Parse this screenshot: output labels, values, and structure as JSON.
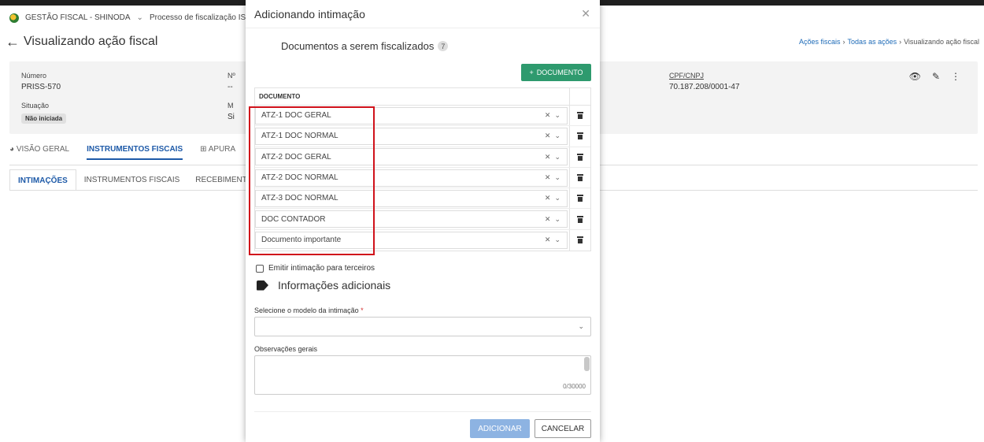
{
  "topbar": {
    "org": "GESTÃO FISCAL - SHINODA",
    "process": "Processo de fiscalização ISS"
  },
  "page": {
    "title": "Visualizando ação fiscal",
    "breadcrumb": [
      "Ações fiscais",
      "Todas as ações",
      "Visualizando ação fiscal"
    ]
  },
  "summary": {
    "numero_label": "Número",
    "numero_value": "PRISS-570",
    "situacao_label": "Situação",
    "situacao_value": "Não iniciada",
    "col2_label_a": "Nº",
    "col2_value_a": "--",
    "col2_label_b": "M",
    "col2_value_b": "Si",
    "cpf_label": "CPF/CNPJ",
    "cpf_value": "70.187.208/0001-47"
  },
  "tabs": {
    "main": [
      "VISÃO GERAL",
      "INSTRUMENTOS FISCAIS",
      "APURA"
    ],
    "sub": [
      "INTIMAÇÕES",
      "INSTRUMENTOS FISCAIS",
      "RECEBIMENT"
    ]
  },
  "modal": {
    "title": "Adicionando intimação",
    "section_title": "Documentos a serem fiscalizados",
    "doc_count": "7",
    "add_doc_label": "DOCUMENTO",
    "table_header": "DOCUMENTO",
    "documents": [
      "ATZ-1 DOC GERAL",
      "ATZ-1 DOC NORMAL",
      "ATZ-2 DOC GERAL",
      "ATZ-2 DOC NORMAL",
      "ATZ-3 DOC NORMAL",
      "DOC CONTADOR",
      "Documento importante"
    ],
    "checkbox_label": "Emitir intimação para terceiros",
    "info_title": "Informações adicionais",
    "model_label": "Selecione o modelo da intimação",
    "model_required": "*",
    "obs_label": "Observações gerais",
    "char_count": "0/30000",
    "add_button": "ADICIONAR",
    "cancel_button": "CANCELAR"
  },
  "colors": {
    "accent": "#1e5aa8",
    "success": "#2e9a6e",
    "highlight": "#d0121b",
    "primary_disabled": "#8db3e2"
  }
}
